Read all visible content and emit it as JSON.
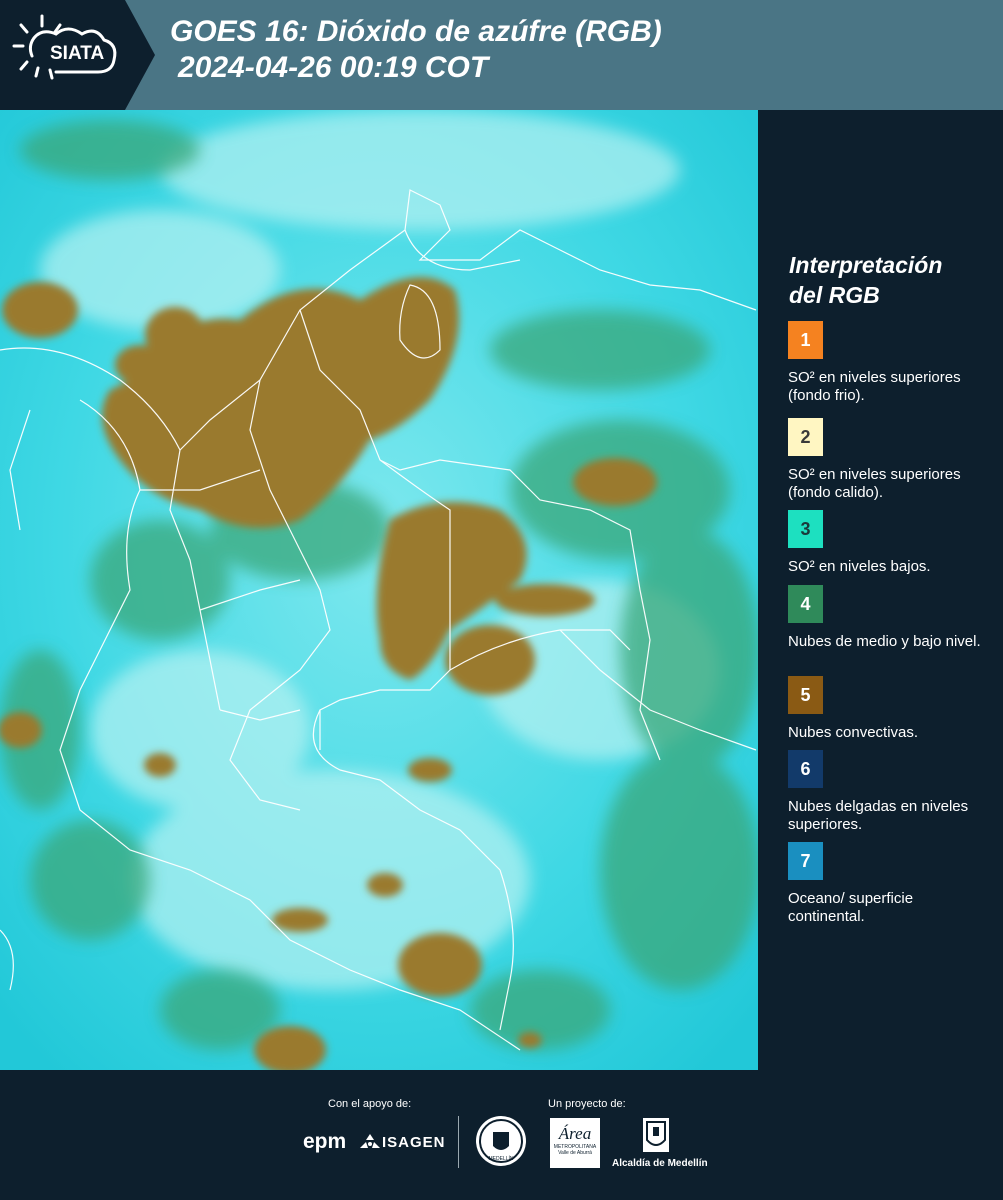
{
  "header": {
    "logo_text": "SIATA",
    "title_line1": "GOES 16: Dióxido de azúfre (RGB)",
    "title_line2": "2024-04-26 00:19 COT"
  },
  "legend": {
    "title_line1": "Interpretación",
    "title_line2": "del RGB",
    "items": [
      {
        "number": "1",
        "color": "#f58220",
        "text_color": "#ffffff",
        "label": "SO² en niveles superiores (fondo frio)."
      },
      {
        "number": "2",
        "color": "#fff6c2",
        "text_color": "#3a3a3a",
        "label": "SO² en niveles superiores (fondo calido)."
      },
      {
        "number": "3",
        "color": "#1de0c0",
        "text_color": "#1a3a3a",
        "label": "SO² en niveles bajos."
      },
      {
        "number": "4",
        "color": "#2f8a5a",
        "text_color": "#ffffff",
        "label": "Nubes de medio y bajo nivel."
      },
      {
        "number": "5",
        "color": "#8a5a14",
        "text_color": "#ffffff",
        "label": "Nubes convectivas."
      },
      {
        "number": "6",
        "color": "#123a6a",
        "text_color": "#ffffff",
        "label": "Nubes delgadas en niveles superiores."
      },
      {
        "number": "7",
        "color": "#1a8fc0",
        "text_color": "#ffffff",
        "label": "Oceano/ superficie continental."
      }
    ]
  },
  "footer": {
    "support_label": "Con el apoyo de:",
    "project_label": "Un proyecto de:",
    "sponsor_epm": "epm",
    "sponsor_isagen": "ISAGEN",
    "partner_area": "Área",
    "partner_area_sub": "METROPOLITANA",
    "partner_area_sub2": "Valle de Aburrá",
    "partner_alcaldia": "Alcaldía de Medellín",
    "seal_text": "MEDELLÍN"
  },
  "colors": {
    "background": "#0d1f2d",
    "header": "#4a7585",
    "ocean_cyan": "#2ad4e0",
    "convective_brown": "#9a7a2e",
    "low_cloud_green": "#3aa87a"
  }
}
